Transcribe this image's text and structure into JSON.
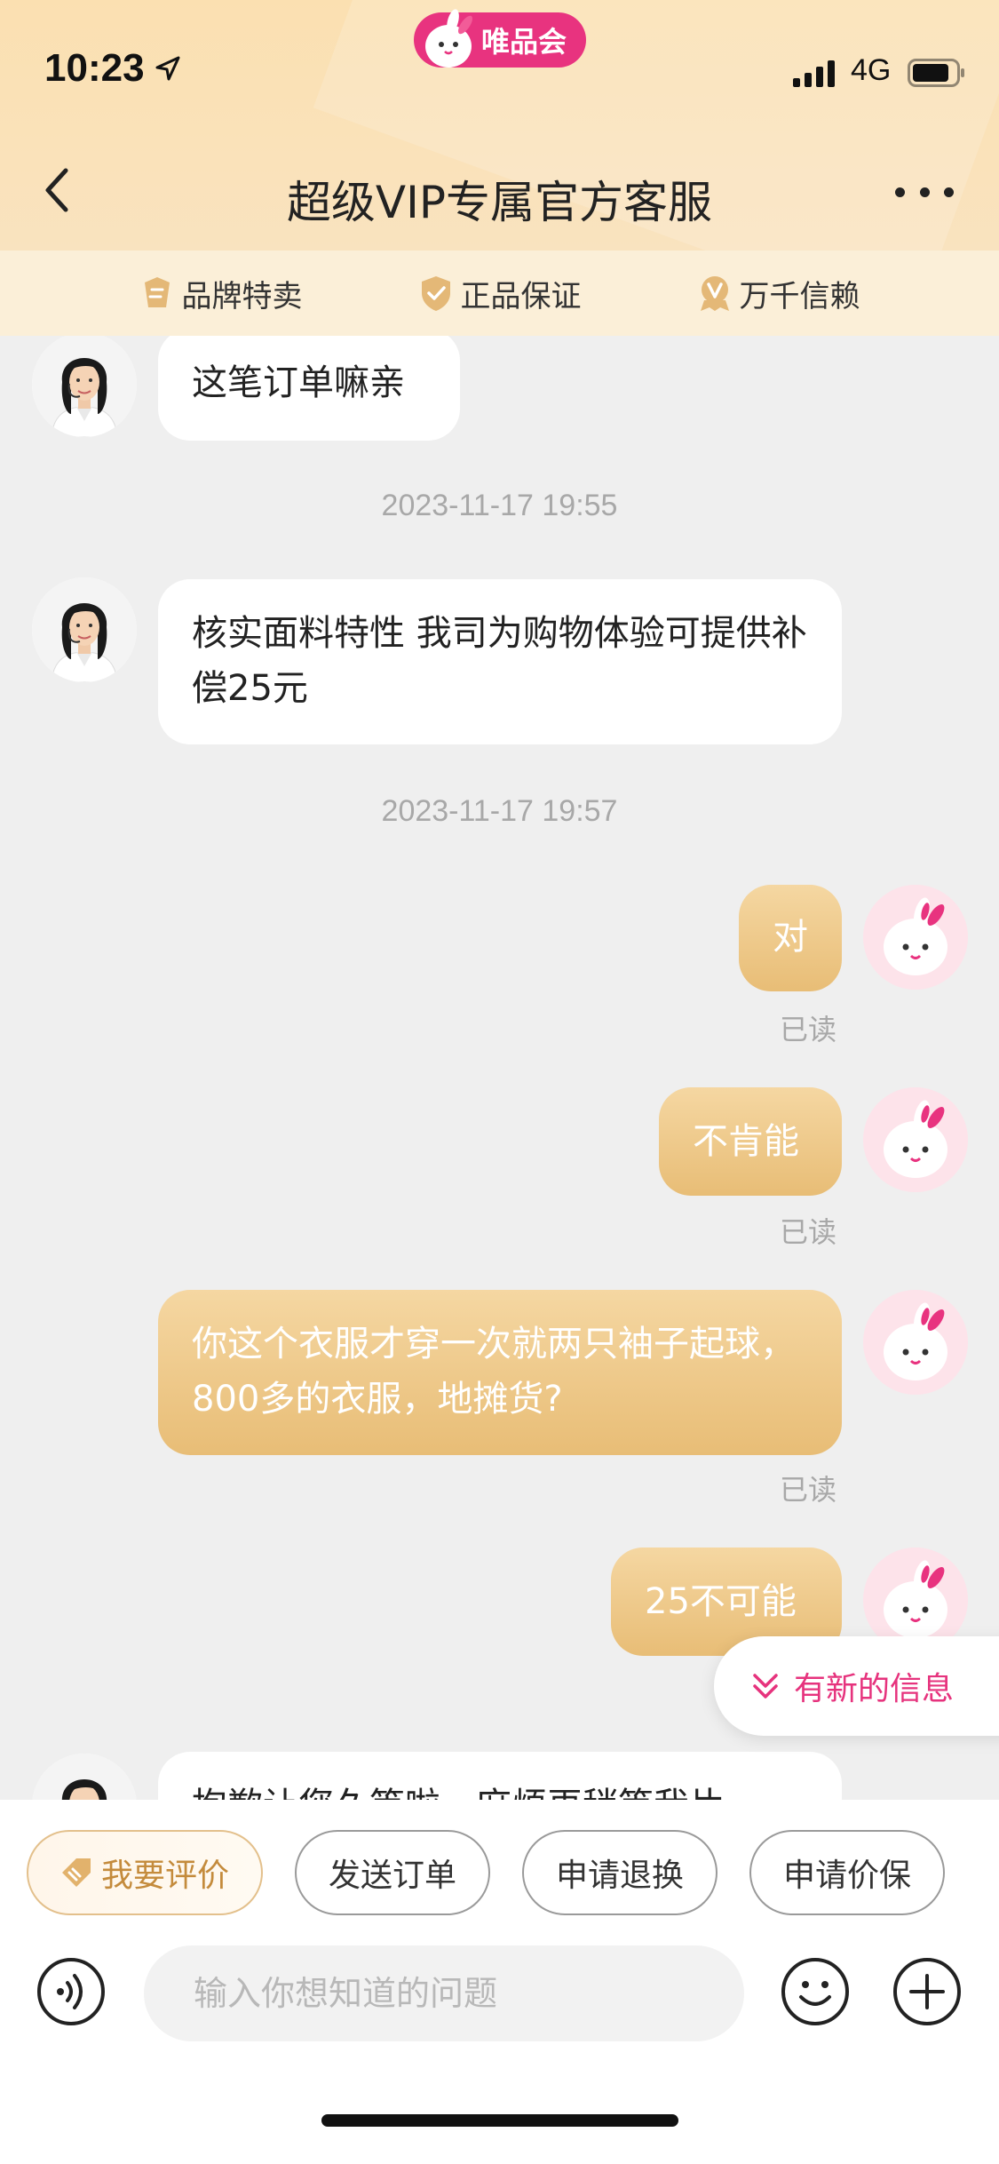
{
  "status_bar": {
    "time": "10:23",
    "network": "4G",
    "brand": "唯品会"
  },
  "nav": {
    "title": "超级VIP专属官方客服"
  },
  "features": [
    {
      "label": "品牌特卖",
      "icon": "tag-icon"
    },
    {
      "label": "正品保证",
      "icon": "shield-check-icon"
    },
    {
      "label": "万千信赖",
      "icon": "v-medal-icon"
    }
  ],
  "messages": {
    "m1": {
      "text": "这笔订单嘛亲"
    },
    "ts1": "2023-11-17 19:55",
    "m2": {
      "text": "核实面料特性 我司为购物体验可提供补偿25元"
    },
    "ts2": "2023-11-17 19:57",
    "m3": {
      "text": "对",
      "status": "已读"
    },
    "m4": {
      "text": "不肯能",
      "status": "已读"
    },
    "m5": {
      "text": "你这个衣服才穿一次就两只袖子起球，800多的衣服，地摊货?",
      "status": "已读"
    },
    "m6": {
      "text": "25不可能"
    },
    "m7": {
      "text": "抱歉让您久等啦，麻烦再稍等我片"
    }
  },
  "new_message_label": "有新的信息",
  "quick_actions": [
    "我要评价",
    "发送订单",
    "申请退换",
    "申请价保"
  ],
  "input": {
    "placeholder": "输入你想知道的问题"
  },
  "colors": {
    "brand_pink": "#e8337f",
    "bubble_gold": "#e8bd76",
    "header_bg": "#fbe0b1"
  }
}
